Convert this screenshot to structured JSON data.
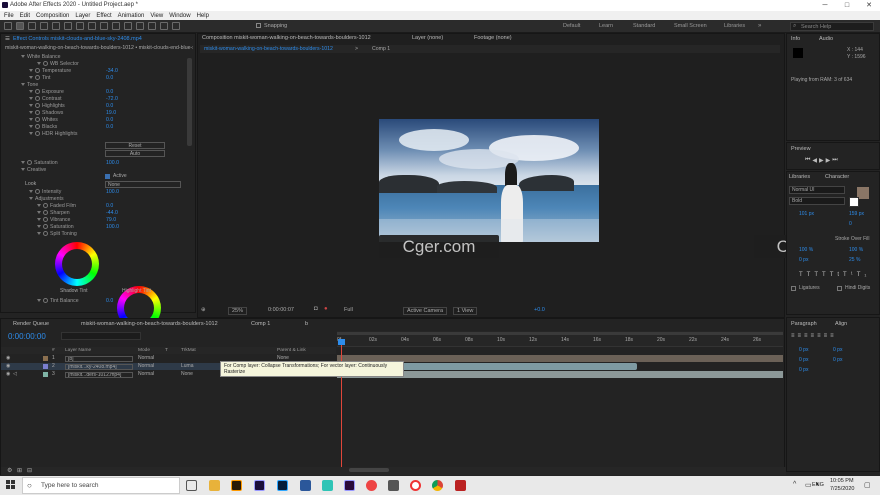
{
  "titlebar": {
    "title": "Adobe After Effects 2020 - Untitled Project.aep *",
    "min": "─",
    "max": "□",
    "close": "✕"
  },
  "menu": [
    "File",
    "Edit",
    "Composition",
    "Layer",
    "Effect",
    "Animation",
    "View",
    "Window",
    "Help"
  ],
  "toolbar": {
    "snapping": "Snapping",
    "workspaces": [
      "Default",
      "Learn",
      "Standard",
      "Small Screen",
      "Libraries"
    ],
    "active_workspace": "Standard",
    "search_placeholder": "Search Help"
  },
  "effect_controls": {
    "tab": "Effect Controls  miskit-clouds-and-blue-sky-2408.mp4",
    "layer_path": "miskit-woman-walking-on-beach-towards-boulders-1012 • miskit-clouds-end-blue-sky...",
    "rows": [
      {
        "label": "White Balance",
        "indent": 0,
        "value": ""
      },
      {
        "label": "WB Selector",
        "indent": 2,
        "value": ""
      },
      {
        "label": "Temperature",
        "indent": 1,
        "value": "-34.0"
      },
      {
        "label": "Tint",
        "indent": 1,
        "value": "0.0"
      },
      {
        "label": "Tone",
        "indent": 0,
        "value": ""
      },
      {
        "label": "Exposure",
        "indent": 1,
        "value": "0.0"
      },
      {
        "label": "Contrast",
        "indent": 1,
        "value": "-72.0"
      },
      {
        "label": "Highlights",
        "indent": 1,
        "value": "0.0"
      },
      {
        "label": "Shadows",
        "indent": 1,
        "value": "19.0"
      },
      {
        "label": "Whites",
        "indent": 1,
        "value": "0.0"
      },
      {
        "label": "Blacks",
        "indent": 1,
        "value": "0.0"
      },
      {
        "label": "HDR Highlights",
        "indent": 1,
        "value": ""
      }
    ],
    "reset": "Reset",
    "auto": "Auto",
    "saturation_label": "Saturation",
    "saturation_value": "100.0",
    "creative": "Creative",
    "active": "Active",
    "look_label": "Look",
    "look_value": "None",
    "intensity_label": "Intensity",
    "intensity_value": "100.0",
    "adjustments": "Adjustments",
    "adj_rows": [
      {
        "label": "Faded Film",
        "value": "0.0"
      },
      {
        "label": "Sharpen",
        "value": "-44.0"
      },
      {
        "label": "Vibrance",
        "value": "79.0"
      },
      {
        "label": "Saturation",
        "value": "100.0"
      },
      {
        "label": "Split Toning",
        "value": ""
      }
    ],
    "shadow_tint": "Shadow Tint",
    "highlight_tint": "Highlight Tint",
    "tint_balance_label": "Tint Balance",
    "tint_balance_value": "0.0"
  },
  "composition": {
    "tab": "Composition  miskit-woman-walking-on-beach-towards-boulders-1012",
    "subtab": "miskit-woman-walking-on-beach-towards-boulders-1012",
    "subtab2": "Comp 1",
    "layer_tab": "Layer  (none)",
    "footage_tab": "Footage  (none)",
    "zoom": "25%",
    "timecode": "0:00:00:07",
    "resolution": "Full",
    "camera": "Active Camera",
    "view": "1 View",
    "exposure": "+0.0"
  },
  "watermarks": [
    "Cger.com",
    "Cger.com"
  ],
  "info_panel": {
    "tabs": [
      "Info",
      "Audio"
    ],
    "x": "X : 144",
    "y": "Y : 1596",
    "status": "Playing from RAM: 3 of 634",
    "preview": "Preview",
    "libraries": "Libraries",
    "character": "Character",
    "font": "Normal UI",
    "style": "Bold",
    "size": "101 px",
    "leading": "159 px",
    "tracking": "0",
    "stroke": "Stroke Over Fill",
    "scale_v": "100 %",
    "scale_h": "100 %",
    "baseline": "0 px",
    "tsume": "25 %",
    "ligatures": "Ligatures",
    "hindi_digits": "Hindi Digits",
    "paragraph": "Paragraph",
    "align": "Align",
    "p_values": [
      "0 px",
      "0 px",
      "0 px",
      "0 px",
      "0 px"
    ]
  },
  "timeline": {
    "render_queue": "Render Queue",
    "tabs": [
      "miskit-woman-walking-on-beach-towards-boulders-1012",
      "Comp 1",
      "b"
    ],
    "timecode": "0:00:00:00",
    "columns": [
      "#",
      "Layer Name",
      "Mode",
      "T",
      "TrkMat",
      "Parent & Link"
    ],
    "layers": [
      {
        "num": "1",
        "name": "[b]",
        "mode": "Normal",
        "trkmat": "",
        "parent": "None"
      },
      {
        "num": "2",
        "name": "[miskit...ky-2408.mp4]",
        "mode": "Normal",
        "trkmat": "Luma",
        "parent": "None"
      },
      {
        "num": "3",
        "name": "[miskit...ders-1012.mp4]",
        "mode": "Normal",
        "trkmat": "None",
        "parent": "None"
      }
    ],
    "ruler": [
      "0f",
      "02s",
      "04s",
      "06s",
      "08s",
      "10s",
      "12s",
      "14s",
      "16s",
      "18s",
      "20s",
      "22s",
      "24s",
      "26s"
    ],
    "tooltip": "For Comp layer: Collapse Transformations; For vector layer: Continuously Rasterize",
    "toggle_label": "Toggle Switches / Modes"
  },
  "taskbar": {
    "search_placeholder": "Type here to search",
    "lang": "ENG",
    "time": "10:05 PM",
    "date": "7/25/2020"
  }
}
